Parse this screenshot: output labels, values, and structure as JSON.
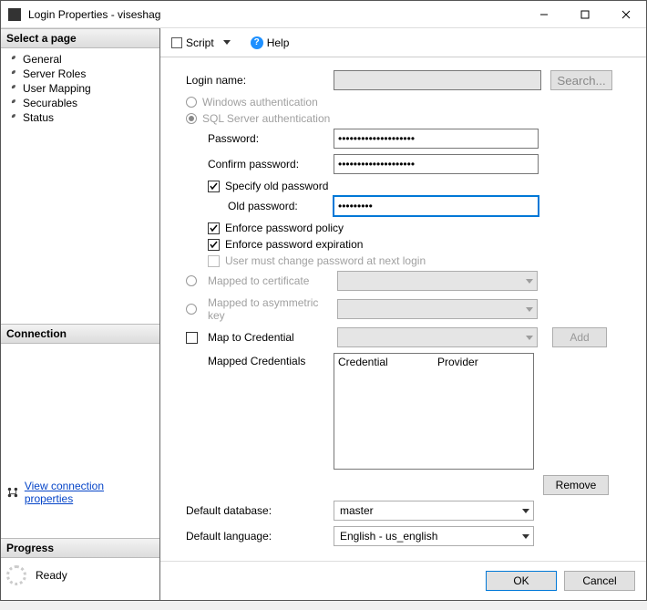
{
  "window": {
    "title": "Login Properties - viseshag"
  },
  "sidebar": {
    "select_page": "Select a page",
    "items": [
      {
        "label": "General"
      },
      {
        "label": "Server Roles"
      },
      {
        "label": "User Mapping"
      },
      {
        "label": "Securables"
      },
      {
        "label": "Status"
      }
    ],
    "connection_hdr": "Connection",
    "link": "View connection properties",
    "progress_hdr": "Progress",
    "ready": "Ready"
  },
  "toolbar": {
    "script": "Script",
    "help": "Help"
  },
  "form": {
    "login_name_label": "Login name:",
    "search": "Search...",
    "win_auth": "Windows authentication",
    "sql_auth": "SQL Server authentication",
    "password_label": "Password:",
    "confirm_label": "Confirm password:",
    "specify_old": "Specify old password",
    "old_password_label": "Old password:",
    "enforce_policy": "Enforce password policy",
    "enforce_exp": "Enforce password expiration",
    "must_change": "User must change password at next login",
    "mapped_cert": "Mapped to certificate",
    "mapped_asym": "Mapped to asymmetric key",
    "map_cred": "Map to Credential",
    "add": "Add",
    "mapped_creds": "Mapped Credentials",
    "cred_col": "Credential",
    "prov_col": "Provider",
    "remove": "Remove",
    "def_db_label": "Default database:",
    "def_db": "master",
    "def_lang_label": "Default language:",
    "def_lang": "English - us_english",
    "password_value": "••••••••••••••••••••",
    "confirm_value": "••••••••••••••••••••",
    "old_value": "•••••••••"
  },
  "footer": {
    "ok": "OK",
    "cancel": "Cancel"
  }
}
